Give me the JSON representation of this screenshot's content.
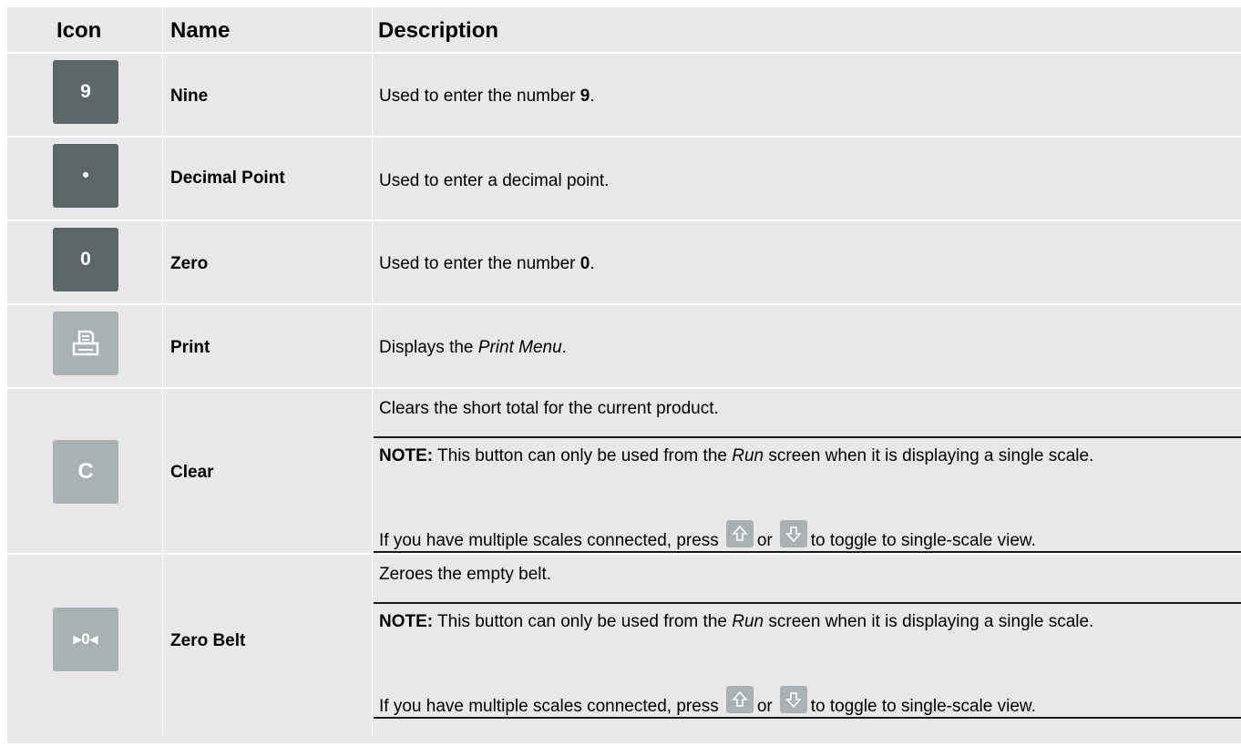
{
  "headers": {
    "icon": "Icon",
    "name": "Name",
    "description": "Description"
  },
  "rows": [
    {
      "icon_label": "9",
      "icon_name": "nine-key-icon",
      "name": "Nine",
      "desc_prefix": "Used to enter the number ",
      "desc_bold": "9",
      "desc_suffix": "."
    },
    {
      "icon_label": "•",
      "icon_name": "decimal-point-key-icon",
      "name": "Decimal Point",
      "description": "Used to enter a decimal point."
    },
    {
      "icon_label": "0",
      "icon_name": "zero-key-icon",
      "name": "Zero",
      "desc_prefix": "Used to enter the number ",
      "desc_bold": "0",
      "desc_suffix": "."
    },
    {
      "icon_name": "print-icon",
      "name": "Print",
      "desc_prefix": "Displays the ",
      "desc_italic": "Print Menu",
      "desc_suffix": "."
    },
    {
      "icon_label": "C",
      "icon_name": "clear-key-icon",
      "name": "Clear",
      "description": "Clears the short total for the current product.",
      "note_label": "NOTE:",
      "note_pre": " This button can only be used from the ",
      "note_italic": "Run",
      "note_post": " screen when it is displaying a single scale.",
      "toggle_pre": "If you have multiple scales connected, press",
      "toggle_or": "or",
      "toggle_post": "to toggle to single-scale view."
    },
    {
      "icon_label": "▸0◂",
      "icon_name": "zero-belt-key-icon",
      "name": "Zero Belt",
      "description": "Zeroes the empty belt.",
      "note_label": "NOTE:",
      "note_pre": " This button can only be used from the ",
      "note_italic": "Run",
      "note_post": " screen when it is displaying a single scale.",
      "toggle_pre": "If you have multiple scales connected, press",
      "toggle_or": "or",
      "toggle_post": "to toggle to single-scale view."
    }
  ],
  "colors": {
    "dark_key": "#5d6769",
    "light_key": "#a9b1b3",
    "table_bg": "#e8e8e8"
  },
  "icons": {
    "up": "up-arrow-icon",
    "down": "down-arrow-icon"
  }
}
